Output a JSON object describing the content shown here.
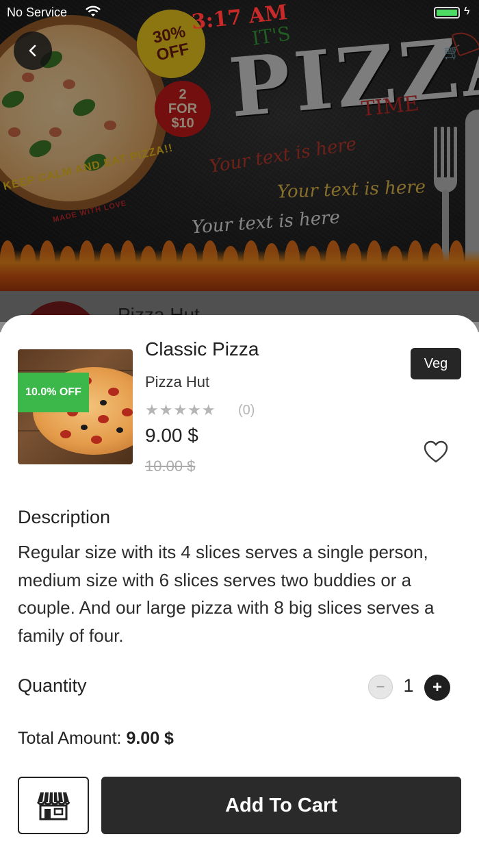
{
  "status_bar": {
    "carrier": "No Service",
    "time": "3:17 AM",
    "battery_level": 1.0
  },
  "banner": {
    "discount_badge": "30% OFF",
    "deal_line1": "2",
    "deal_line2": "FOR",
    "deal_line3": "$10",
    "its": "IT'S",
    "headline": "PIZZA",
    "time_word": "TIME",
    "script_1": "Your text is here",
    "script_2": "Your text is here",
    "script_3": "Your text is here",
    "arc_text": "KEEP CALM AND EAT PIZZA!!",
    "arc_subtext": "MADE WITH LOVE"
  },
  "background_list": {
    "partial_title": "Pizza Hut"
  },
  "product": {
    "name": "Classic Pizza",
    "restaurant": "Pizza Hut",
    "diet_tag": "Veg",
    "discount_label": "10.0% OFF",
    "rating_stars": "★★★★★",
    "rating_count": "(0)",
    "price": "9.00 $",
    "original_price": "10.00 $",
    "favorited": false
  },
  "description": {
    "title": "Description",
    "text": "Regular size with its 4 slices serves a single person, medium size with 6 slices serves two buddies or a couple. And our large pizza with 8 big slices serves a family of four."
  },
  "quantity": {
    "label": "Quantity",
    "value": "1",
    "minus_symbol": "−",
    "plus_symbol": "+"
  },
  "total": {
    "label": "Total Amount:",
    "value": "9.00 $"
  },
  "actions": {
    "add_to_cart_label": "Add To Cart"
  },
  "icons": {
    "back": "chevron-left-icon",
    "favorite": "heart-outline-icon",
    "store": "storefront-icon",
    "wifi": "wifi-icon",
    "battery": "battery-icon"
  },
  "colors": {
    "discount_green": "#3cb84a",
    "dark_button": "#2a2a2a",
    "battery_green": "#4cd964"
  }
}
